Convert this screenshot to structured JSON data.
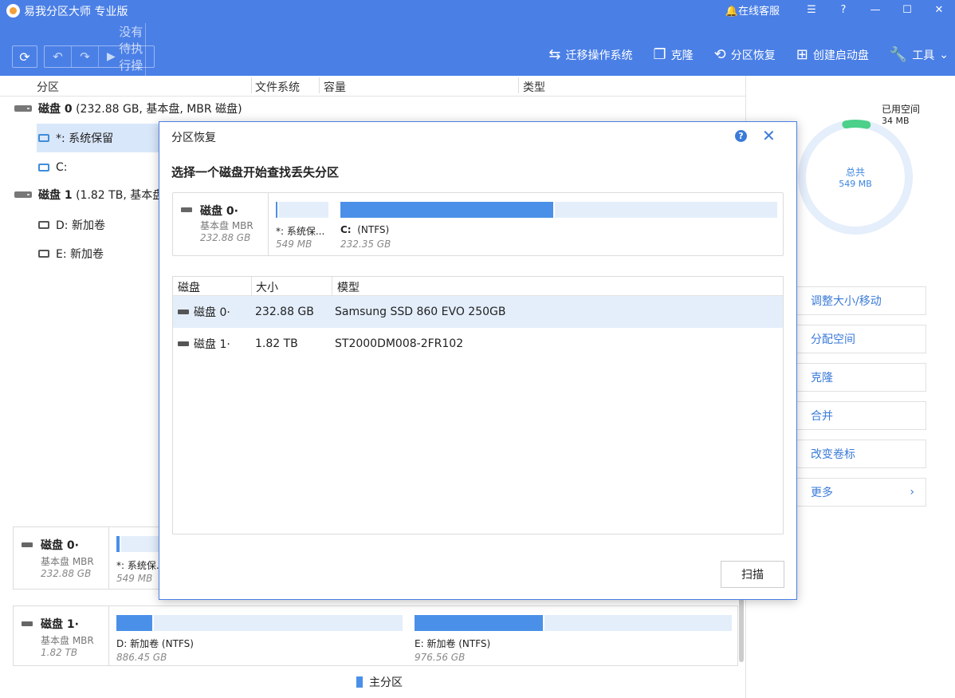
{
  "app": {
    "title": "易我分区大师 专业版",
    "service": "在线客服",
    "pending": "没有待执行操作"
  },
  "toolbar": {
    "migrate": "迁移操作系统",
    "clone": "克隆",
    "recover": "分区恢复",
    "bootdisk": "创建启动盘",
    "tools": "工具"
  },
  "table": {
    "columns": [
      "分区",
      "文件系统",
      "容量",
      "类型"
    ],
    "disk0": {
      "name": "磁盘 0",
      "info": "(232.88 GB, 基本盘, MBR 磁盘)"
    },
    "disk0_parts": [
      "*: 系统保留",
      "C:"
    ],
    "disk1": {
      "name": "磁盘 1",
      "info": "(1.82 TB, 基本盘,"
    },
    "disk1_parts": [
      "D: 新加卷",
      "E: 新加卷"
    ]
  },
  "diskmap": {
    "disk0": {
      "name": "磁盘 0·",
      "type": "基本盘 MBR",
      "size": "232.88 GB",
      "p1_label": "*: 系统保...",
      "p1_size": "549 MB"
    },
    "disk1": {
      "name": "磁盘 1·",
      "type": "基本盘 MBR",
      "size": "1.82 TB",
      "p1_label": "D: 新加卷 (NTFS)",
      "p1_size": "886.45 GB",
      "p1_fill": 0.13,
      "p2_label": "E: 新加卷 (NTFS)",
      "p2_size": "976.56 GB",
      "p2_fill": 0.41
    }
  },
  "legend": "主分区",
  "right": {
    "used_label": "已用空间",
    "used_value": "34 MB",
    "total_label": "总共",
    "total_value": "549 MB",
    "used_fraction": 0.062,
    "ops": [
      "调整大小/移动",
      "分配空间",
      "克隆",
      "合并",
      "改变卷标",
      "更多"
    ]
  },
  "dialog": {
    "title": "分区恢复",
    "heading": "选择一个磁盘开始查找丢失分区",
    "map": {
      "name": "磁盘 0·",
      "type": "基本盘 MBR",
      "size": "232.88 GB",
      "p1_label": "*: 系统保...",
      "p1_size": "549 MB",
      "p1_fill": 0.06,
      "p2_label": "C: (NTFS)",
      "p2_size": "232.35 GB",
      "p2_fill": 0.49
    },
    "columns": [
      "磁盘",
      "大小",
      "模型"
    ],
    "rows": [
      {
        "disk": "磁盘 0·",
        "size": "232.88 GB",
        "model": "Samsung SSD 860 EVO 250GB"
      },
      {
        "disk": "磁盘 1·",
        "size": "1.82 TB",
        "model": "ST2000DM008-2FR102"
      }
    ],
    "scan": "扫描"
  },
  "colors": {
    "accent": "#4a7fe6",
    "partition": "#4a90e8",
    "used": "#4cd08a"
  }
}
